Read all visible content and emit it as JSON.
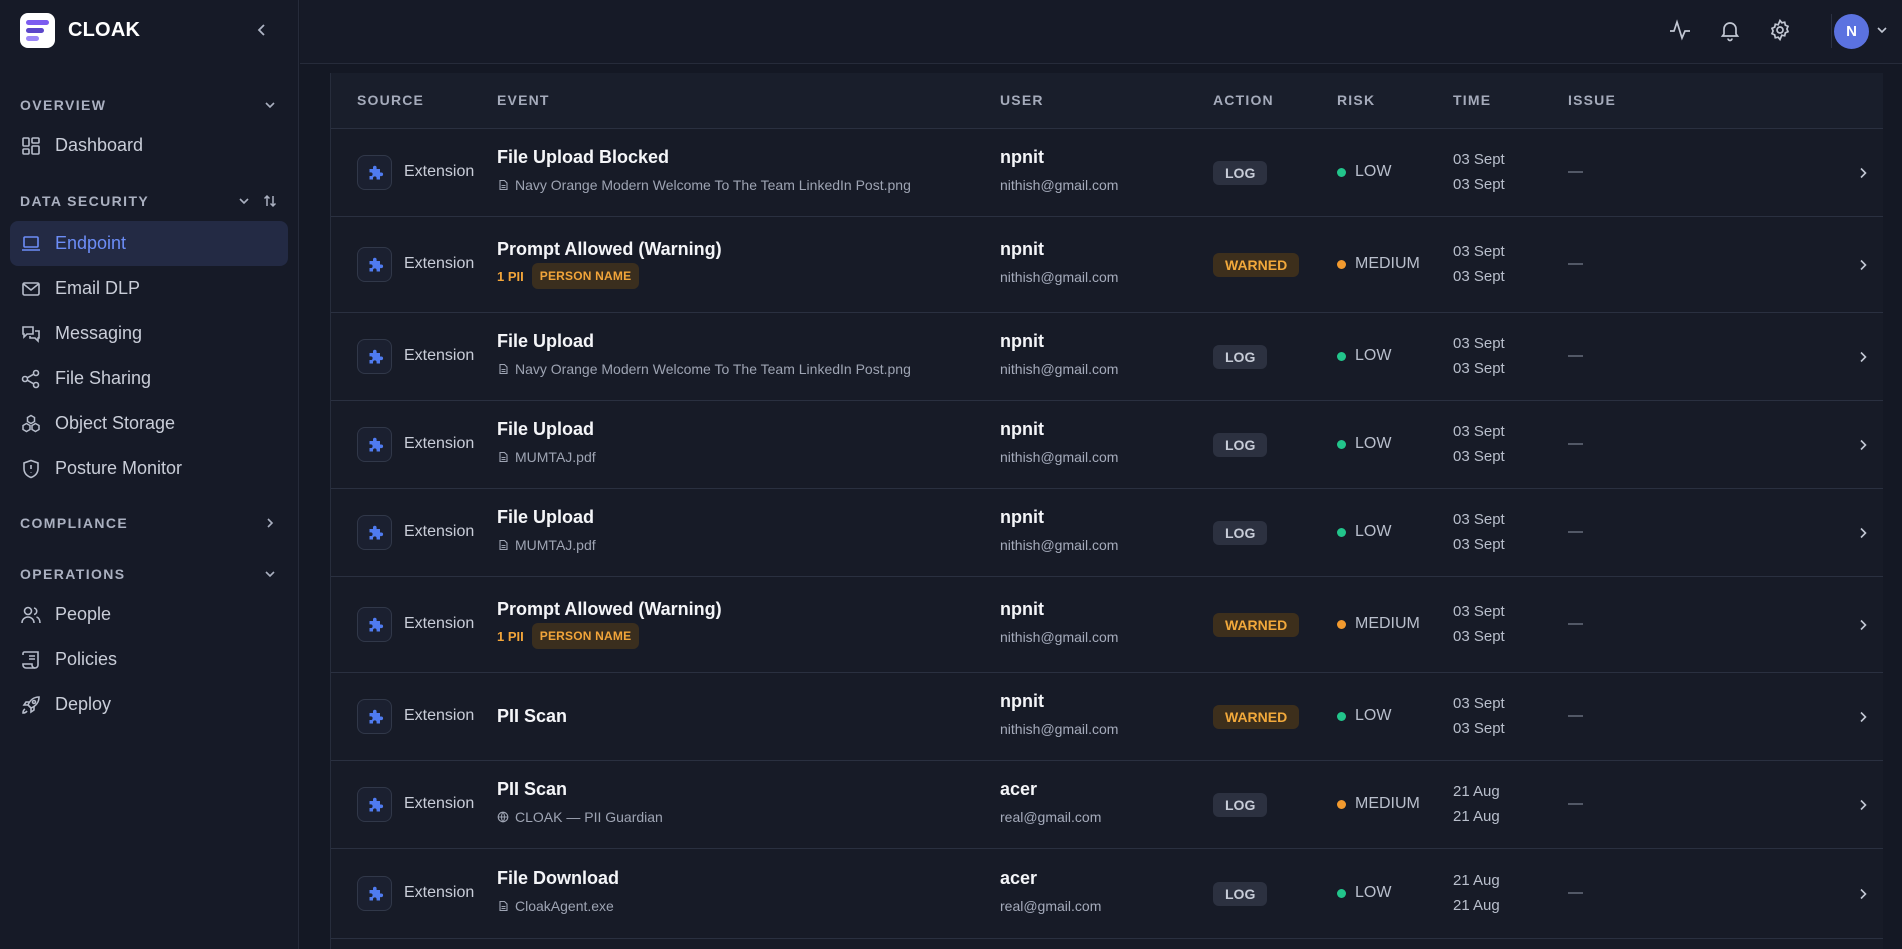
{
  "brand": {
    "name": "CLOAK"
  },
  "sidebar": {
    "sections": [
      {
        "title": "OVERVIEW",
        "items": [
          {
            "label": "Dashboard",
            "icon": "dashboard-icon"
          }
        ]
      },
      {
        "title": "DATA SECURITY",
        "items": [
          {
            "label": "Endpoint",
            "icon": "laptop-icon",
            "active": true
          },
          {
            "label": "Email DLP",
            "icon": "mail-icon"
          },
          {
            "label": "Messaging",
            "icon": "chat-icon"
          },
          {
            "label": "File Sharing",
            "icon": "share-icon"
          },
          {
            "label": "Object Storage",
            "icon": "boxes-icon"
          },
          {
            "label": "Posture Monitor",
            "icon": "shield-icon"
          }
        ]
      },
      {
        "title": "COMPLIANCE",
        "items": []
      },
      {
        "title": "OPERATIONS",
        "items": [
          {
            "label": "People",
            "icon": "people-icon"
          },
          {
            "label": "Policies",
            "icon": "scroll-icon"
          },
          {
            "label": "Deploy",
            "icon": "rocket-icon"
          }
        ]
      }
    ]
  },
  "topbar": {
    "avatar_initial": "N"
  },
  "table": {
    "columns": [
      "SOURCE",
      "EVENT",
      "USER",
      "ACTION",
      "RISK",
      "TIME",
      "ISSUE"
    ],
    "rows": [
      {
        "source": "Extension",
        "title": "File Upload Blocked",
        "sub_type": "file",
        "sub": "Navy Orange Modern Welcome To The Team LinkedIn Post.png",
        "user": "npnit",
        "email": "nithish@gmail.com",
        "action": "LOG",
        "risk": "LOW",
        "time1": "03 Sept",
        "time2": "03 Sept",
        "issue": "—"
      },
      {
        "source": "Extension",
        "title": "Prompt Allowed (Warning)",
        "sub_type": "pii",
        "pii_count": "1 PII",
        "pii_tag": "PERSON NAME",
        "user": "npnit",
        "email": "nithish@gmail.com",
        "action": "WARNED",
        "risk": "MEDIUM",
        "time1": "03 Sept",
        "time2": "03 Sept",
        "issue": "—"
      },
      {
        "source": "Extension",
        "title": "File Upload",
        "sub_type": "file",
        "sub": "Navy Orange Modern Welcome To The Team LinkedIn Post.png",
        "user": "npnit",
        "email": "nithish@gmail.com",
        "action": "LOG",
        "risk": "LOW",
        "time1": "03 Sept",
        "time2": "03 Sept",
        "issue": "—"
      },
      {
        "source": "Extension",
        "title": "File Upload",
        "sub_type": "file",
        "sub": "MUMTAJ.pdf",
        "user": "npnit",
        "email": "nithish@gmail.com",
        "action": "LOG",
        "risk": "LOW",
        "time1": "03 Sept",
        "time2": "03 Sept",
        "issue": "—"
      },
      {
        "source": "Extension",
        "title": "File Upload",
        "sub_type": "file",
        "sub": "MUMTAJ.pdf",
        "user": "npnit",
        "email": "nithish@gmail.com",
        "action": "LOG",
        "risk": "LOW",
        "time1": "03 Sept",
        "time2": "03 Sept",
        "issue": "—"
      },
      {
        "source": "Extension",
        "title": "Prompt Allowed (Warning)",
        "sub_type": "pii",
        "pii_count": "1 PII",
        "pii_tag": "PERSON NAME",
        "user": "npnit",
        "email": "nithish@gmail.com",
        "action": "WARNED",
        "risk": "MEDIUM",
        "time1": "03 Sept",
        "time2": "03 Sept",
        "issue": "—"
      },
      {
        "source": "Extension",
        "title": "PII Scan",
        "sub_type": "none",
        "user": "npnit",
        "email": "nithish@gmail.com",
        "action": "WARNED",
        "risk": "LOW",
        "time1": "03 Sept",
        "time2": "03 Sept",
        "issue": "—"
      },
      {
        "source": "Extension",
        "title": "PII Scan",
        "sub_type": "web",
        "sub": "CLOAK — PII Guardian",
        "user": "acer",
        "email": "real@gmail.com",
        "action": "LOG",
        "risk": "MEDIUM",
        "time1": "21 Aug",
        "time2": "21 Aug",
        "issue": "—"
      },
      {
        "source": "Extension",
        "title": "File Download",
        "sub_type": "file",
        "sub": "CloakAgent.exe",
        "user": "acer",
        "email": "real@gmail.com",
        "action": "LOG",
        "risk": "LOW",
        "time1": "21 Aug",
        "time2": "21 Aug",
        "issue": "—"
      }
    ]
  },
  "colors": {
    "low": "#22c58b",
    "medium": "#f29a2e",
    "accent": "#6c8df7"
  }
}
